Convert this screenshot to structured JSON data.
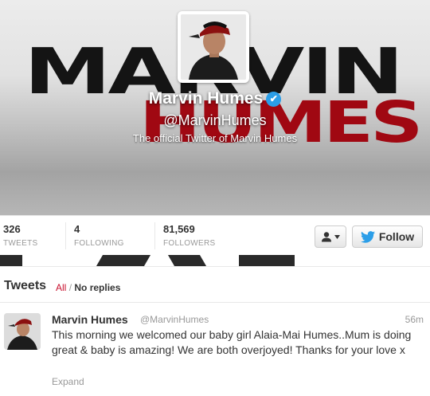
{
  "header": {
    "banner_word_1": "MARVIN",
    "banner_word_2": "HUMES",
    "name": "Marvin Humes",
    "verified_glyph": "✔",
    "handle": "@MarvinHumes",
    "bio": "The official Twitter of Marvin Humes"
  },
  "stats": [
    {
      "value": "326",
      "label": "TWEETS"
    },
    {
      "value": "4",
      "label": "FOLLOWING"
    },
    {
      "value": "81,569",
      "label": "FOLLOWERS"
    }
  ],
  "actions": {
    "user_dropdown_icon": "user-icon",
    "follow_label": "Follow",
    "follow_icon": "twitter-bird-icon"
  },
  "tweets_section": {
    "title": "Tweets",
    "filter_all": "All",
    "filter_separator": "/",
    "filter_no_replies": "No replies"
  },
  "tweet": {
    "author": "Marvin Humes",
    "handle": "@MarvinHumes",
    "time": "56m",
    "text": "This morning we welcomed our baby girl Alaia-Mai Humes..Mum is doing great & baby is amazing! We are both overjoyed! Thanks for your love x",
    "expand": "Expand"
  },
  "colors": {
    "verified": "#2b9ee8",
    "twitter_blue": "#2b9ee8",
    "accent_red": "#c8102e",
    "banner_red": "#a00812"
  }
}
